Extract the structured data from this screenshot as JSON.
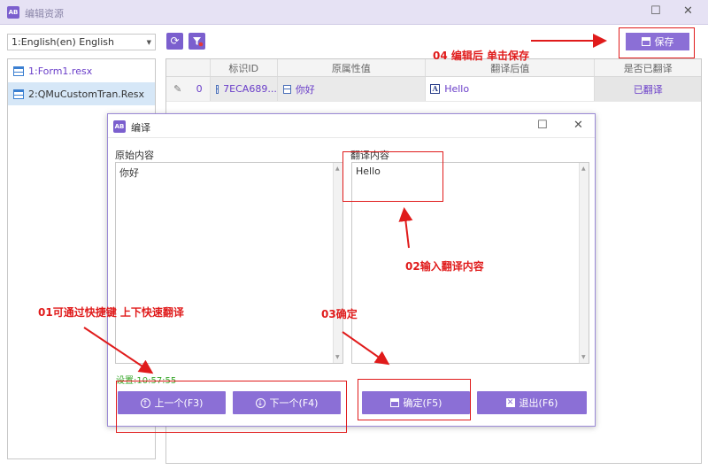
{
  "window": {
    "title": "编辑资源",
    "icon_text": "AB",
    "controls": {
      "minimize": "—",
      "maximize": "☐",
      "close": "✕"
    }
  },
  "language_select": {
    "value": "1:English(en) English"
  },
  "toolbar": {
    "refresh_icon": "refresh-icon",
    "filter_icon": "filter-icon",
    "save_label": "保存"
  },
  "files": [
    {
      "label": "1:Form1.resx",
      "selected": false
    },
    {
      "label": "2:QMuCustomTran.Resx",
      "selected": true
    }
  ],
  "grid": {
    "headers": [
      "",
      "标识ID",
      "原属性值",
      "翻译后值",
      "是否已翻译"
    ],
    "rows": [
      {
        "index": "0",
        "id": "7ECA689...",
        "original": "你好",
        "translated": "Hello",
        "status": "已翻译"
      }
    ]
  },
  "dialog": {
    "title": "编译",
    "icon_text": "AB",
    "original_label": "原始内容",
    "original_text": "你好",
    "translated_label": "翻译内容",
    "translated_text": "Hello",
    "status_text": "设置:10:57:55",
    "buttons": {
      "prev": "上一个(F3)",
      "next": "下一个(F4)",
      "ok": "确定(F5)",
      "exit": "退出(F6)"
    }
  },
  "annotations": {
    "save": "04 编辑后 单击保存",
    "input": "02输入翻译内容",
    "shortcut": "01可通过快捷键 上下快速翻译",
    "confirm": "03确定"
  },
  "colors": {
    "accent": "#8b6fd6",
    "annotation": "#e01b1b",
    "status_green": "#3aa82c"
  }
}
